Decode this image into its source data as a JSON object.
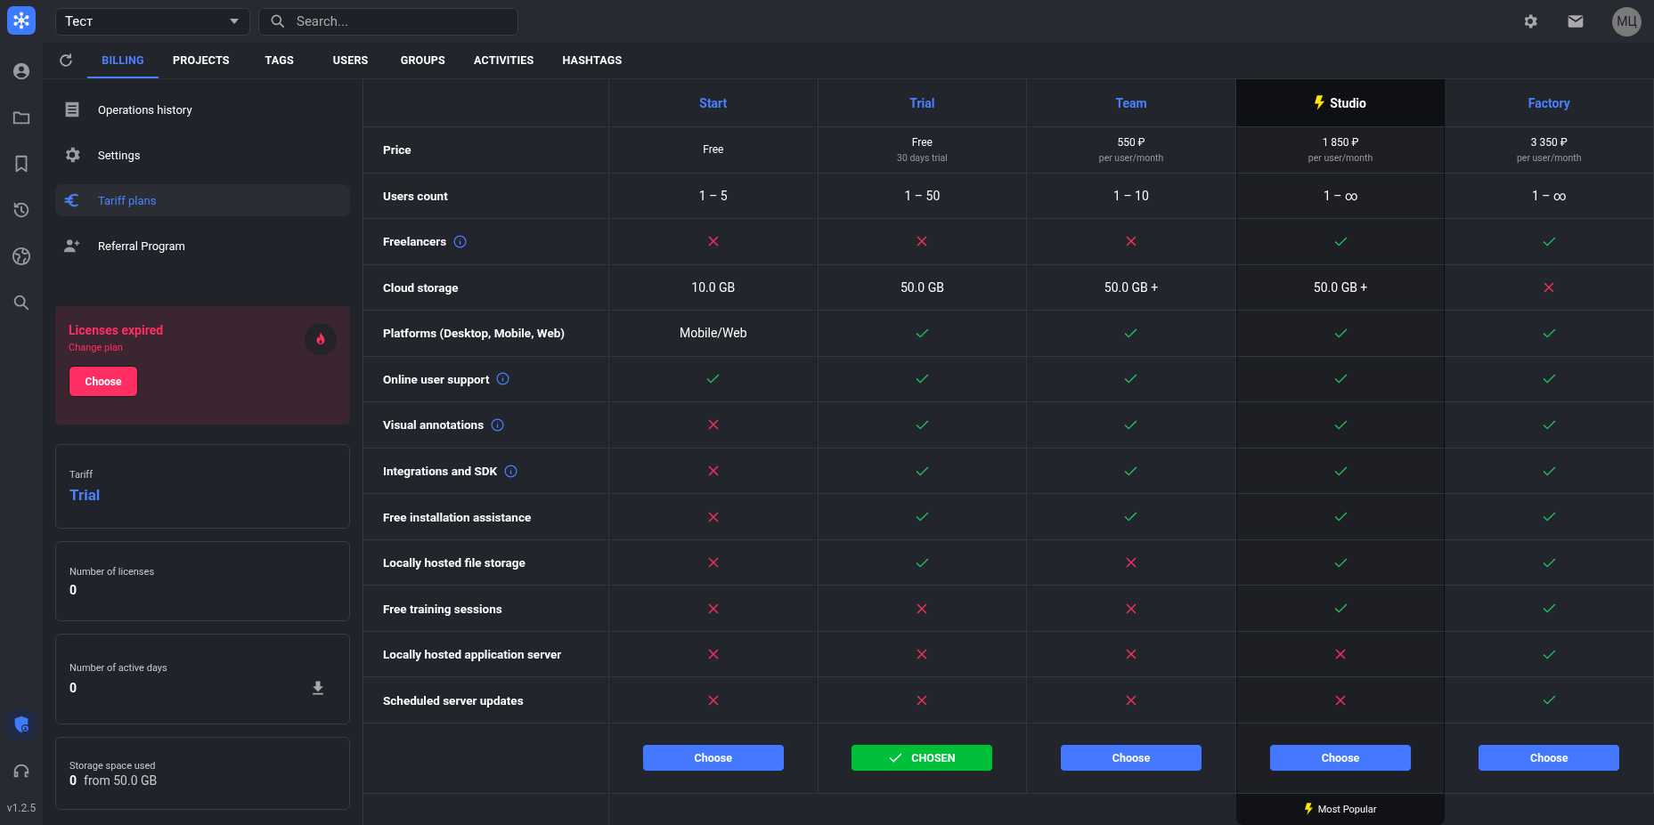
{
  "topbar": {
    "workspace": "Тест",
    "search_placeholder": "Search...",
    "avatar": "МЦ"
  },
  "rail": {
    "items": [
      {
        "selected": false
      },
      {
        "selected": false
      },
      {
        "selected": false
      },
      {
        "selected": false
      },
      {
        "selected": false
      },
      {
        "selected": false
      }
    ],
    "bottom": [
      {
        "selected": true
      },
      {
        "selected": false
      }
    ],
    "version": "v1.2.5"
  },
  "tabs": [
    {
      "label": "BILLING",
      "selected": true
    },
    {
      "label": "PROJECTS",
      "selected": false
    },
    {
      "label": "TAGS",
      "selected": false
    },
    {
      "label": "USERS",
      "selected": false
    },
    {
      "label": "GROUPS",
      "selected": false
    },
    {
      "label": "ACTIVITIES",
      "selected": false
    },
    {
      "label": "HASHTAGS",
      "selected": false
    }
  ],
  "sidebar": {
    "items": [
      {
        "label": "Operations history",
        "selected": false
      },
      {
        "label": "Settings",
        "selected": false
      },
      {
        "label": "Tariff plans",
        "selected": true
      },
      {
        "label": "Referral Program",
        "selected": false
      }
    ],
    "alert": {
      "title": "Licenses expired",
      "subtitle": "Change plan",
      "button": "Choose"
    },
    "cards": [
      {
        "kind": "highlight",
        "label": "Tariff",
        "value": "Trial"
      },
      {
        "kind": "plain",
        "label": "Number of licenses",
        "value": "0"
      },
      {
        "kind": "download",
        "label": "Number of active days",
        "value": "0"
      },
      {
        "kind": "plain",
        "label": "Storage space used",
        "value": "0",
        "suffix": "from 50.0 GB"
      }
    ]
  },
  "table": {
    "plans": [
      {
        "name": "Start",
        "highlighted": false,
        "button": {
          "label": "Choose",
          "chosen": false
        }
      },
      {
        "name": "Trial",
        "highlighted": false,
        "button": {
          "label": "CHOSEN",
          "chosen": true
        }
      },
      {
        "name": "Team",
        "highlighted": false,
        "button": {
          "label": "Choose",
          "chosen": false
        }
      },
      {
        "name": "Studio",
        "highlighted": true,
        "button": {
          "label": "Choose",
          "chosen": false
        },
        "badge": "Most Popular"
      },
      {
        "name": "Factory",
        "highlighted": false,
        "button": {
          "label": "Choose",
          "chosen": false
        }
      }
    ],
    "rows": [
      {
        "label": "Price",
        "info": false,
        "cells": [
          {
            "kind": "price",
            "text": "Free"
          },
          {
            "kind": "price",
            "text": "Free",
            "sub": "30 days trial"
          },
          {
            "kind": "price",
            "text": "550 ₽",
            "sub": "per user/month"
          },
          {
            "kind": "price",
            "text": "1 850 ₽",
            "sub": "per user/month"
          },
          {
            "kind": "price",
            "text": "3 350 ₽",
            "sub": "per user/month"
          }
        ]
      },
      {
        "label": "Users count",
        "info": false,
        "cells": [
          {
            "kind": "text",
            "text": "1 – 5"
          },
          {
            "kind": "text",
            "text": "1 – 50"
          },
          {
            "kind": "text",
            "text": "1 – 10"
          },
          {
            "kind": "text",
            "text": "1 – ∞"
          },
          {
            "kind": "text",
            "text": "1 – ∞"
          }
        ]
      },
      {
        "label": "Freelancers",
        "info": true,
        "cells": [
          {
            "kind": "no"
          },
          {
            "kind": "no"
          },
          {
            "kind": "no"
          },
          {
            "kind": "yes"
          },
          {
            "kind": "yes"
          }
        ]
      },
      {
        "label": "Cloud storage",
        "info": false,
        "cells": [
          {
            "kind": "text",
            "text": "10.0 GB"
          },
          {
            "kind": "text",
            "text": "50.0 GB"
          },
          {
            "kind": "text",
            "text": "50.0 GB +"
          },
          {
            "kind": "text",
            "text": "50.0 GB +"
          },
          {
            "kind": "no"
          }
        ]
      },
      {
        "label": "Platforms (Desktop, Mobile, Web)",
        "info": false,
        "cells": [
          {
            "kind": "text",
            "text": "Mobile/Web"
          },
          {
            "kind": "yes"
          },
          {
            "kind": "yes"
          },
          {
            "kind": "yes"
          },
          {
            "kind": "yes"
          }
        ]
      },
      {
        "label": "Online user support",
        "info": true,
        "cells": [
          {
            "kind": "yes"
          },
          {
            "kind": "yes"
          },
          {
            "kind": "yes"
          },
          {
            "kind": "yes"
          },
          {
            "kind": "yes"
          }
        ]
      },
      {
        "label": "Visual annotations",
        "info": true,
        "cells": [
          {
            "kind": "no"
          },
          {
            "kind": "yes"
          },
          {
            "kind": "yes"
          },
          {
            "kind": "yes"
          },
          {
            "kind": "yes"
          }
        ]
      },
      {
        "label": "Integrations and SDK",
        "info": true,
        "cells": [
          {
            "kind": "no"
          },
          {
            "kind": "yes"
          },
          {
            "kind": "yes"
          },
          {
            "kind": "yes"
          },
          {
            "kind": "yes"
          }
        ]
      },
      {
        "label": "Free installation assistance",
        "info": false,
        "cells": [
          {
            "kind": "no"
          },
          {
            "kind": "yes"
          },
          {
            "kind": "yes"
          },
          {
            "kind": "yes"
          },
          {
            "kind": "yes"
          }
        ]
      },
      {
        "label": "Locally hosted file storage",
        "info": false,
        "cells": [
          {
            "kind": "no"
          },
          {
            "kind": "yes"
          },
          {
            "kind": "no"
          },
          {
            "kind": "yes"
          },
          {
            "kind": "yes"
          }
        ]
      },
      {
        "label": "Free training sessions",
        "info": false,
        "cells": [
          {
            "kind": "no"
          },
          {
            "kind": "no"
          },
          {
            "kind": "no"
          },
          {
            "kind": "yes"
          },
          {
            "kind": "yes"
          }
        ]
      },
      {
        "label": "Locally hosted application server",
        "info": false,
        "cells": [
          {
            "kind": "no"
          },
          {
            "kind": "no"
          },
          {
            "kind": "no"
          },
          {
            "kind": "no"
          },
          {
            "kind": "yes"
          }
        ]
      },
      {
        "label": "Scheduled server updates",
        "info": false,
        "cells": [
          {
            "kind": "no"
          },
          {
            "kind": "no"
          },
          {
            "kind": "no"
          },
          {
            "kind": "no"
          },
          {
            "kind": "yes"
          }
        ]
      }
    ]
  }
}
